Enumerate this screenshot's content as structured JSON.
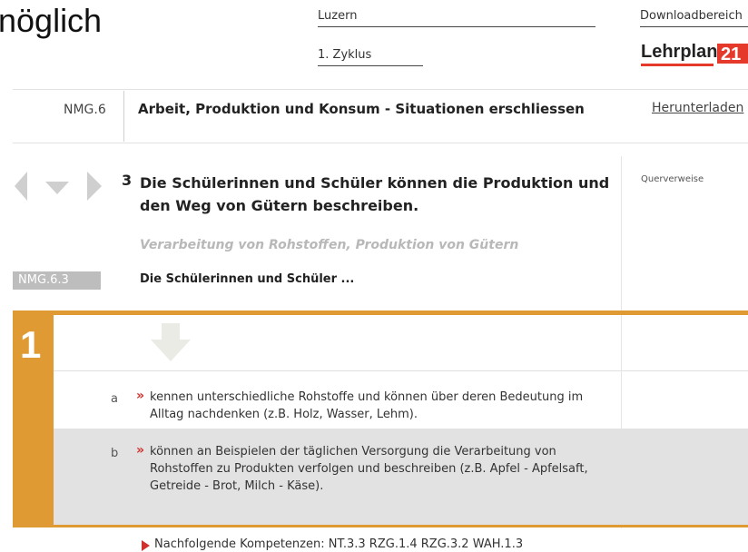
{
  "header": {
    "title_fragment": "nöglich",
    "canton": "Luzern",
    "cycle": "1. Zyklus",
    "download_area": "Downloadbereich",
    "logo_text": "Lehrplan",
    "logo_mark": "21",
    "accent_color": "#e5392b"
  },
  "section": {
    "code": "NMG.6",
    "title": "Arbeit, Produktion und Konsum - Situationen erschliessen",
    "download_link": "Herunterladen"
  },
  "competence": {
    "number": "3",
    "text": "Die Schülerinnen und Schüler können die Produktion und den Weg von Gütern beschreiben.",
    "subtitle": "Verarbeitung von Rohstoffen, Produktion von Gütern",
    "code_badge": "NMG.6.3",
    "pupils_prefix": "Die Schülerinnen und Schüler ...",
    "cross_references_label": "Querverweise",
    "nav_icons": [
      "arrow-left-icon",
      "arrow-down-icon",
      "arrow-right-icon"
    ]
  },
  "level": {
    "number": "1",
    "color": "#e09a34",
    "items": [
      {
        "letter": "a",
        "marker": "»",
        "text": "kennen unterschiedliche Rohstoffe und können über deren Bedeutung im Alltag nachdenken (z.B. Holz, Wasser, Lehm)."
      },
      {
        "letter": "b",
        "marker": "»",
        "text": "können an Beispielen der täglichen Versorgung die Verarbeitung von Rohstoffen zu Produkten verfolgen und beschreiben (z.B. Apfel - Apfelsaft, Getreide - Brot, Milch - Käse)."
      }
    ]
  },
  "following": {
    "text": "Nachfolgende Kompetenzen: NT.3.3 RZG.1.4 RZG.3.2 WAH.1.3"
  }
}
